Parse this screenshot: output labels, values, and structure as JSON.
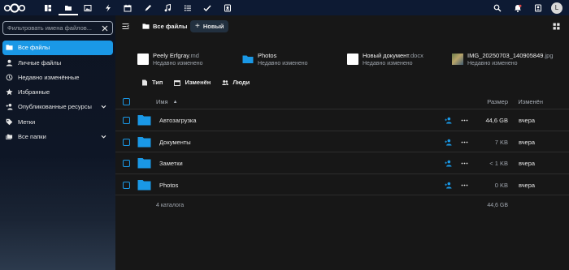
{
  "header": {
    "apps": [
      {
        "icon": "dashboard-icon",
        "active": false
      },
      {
        "icon": "files-icon",
        "active": true
      },
      {
        "icon": "photos-icon",
        "active": false
      },
      {
        "icon": "activity-icon",
        "active": false
      },
      {
        "icon": "calendar-icon",
        "active": false
      },
      {
        "icon": "notes-icon",
        "active": false
      },
      {
        "icon": "music-icon",
        "active": false
      },
      {
        "icon": "tasks-icon",
        "active": false
      },
      {
        "icon": "check-icon",
        "active": false
      },
      {
        "icon": "passwords-icon",
        "active": false
      }
    ],
    "avatar_initial": "L"
  },
  "sidebar": {
    "filter_placeholder": "Фильтровать имена файлов...",
    "items": [
      {
        "label": "Все файлы",
        "icon": "folder-icon",
        "active": true
      },
      {
        "label": "Личные файлы",
        "icon": "account-icon",
        "active": false
      },
      {
        "label": "Недавно изменённые",
        "icon": "history-icon",
        "active": false
      },
      {
        "label": "Избранные",
        "icon": "star-icon",
        "active": false
      },
      {
        "label": "Опубликованные ресурсы",
        "icon": "share-icon",
        "active": false,
        "expandable": true
      },
      {
        "label": "Метки",
        "icon": "tag-icon",
        "active": false
      },
      {
        "label": "Все папки",
        "icon": "folder-multiple-icon",
        "active": false,
        "expandable": true
      }
    ]
  },
  "toolbar": {
    "breadcrumb": "Все файлы",
    "new_label": "Новый"
  },
  "recent": [
    {
      "name": "Peely Erfgray",
      "ext": ".md",
      "sub": "Недавно изменено",
      "thumb": "doc"
    },
    {
      "name": "Photos",
      "ext": "",
      "sub": "Недавно изменено",
      "thumb": "folder"
    },
    {
      "name": "Новый документ",
      "ext": ".docx",
      "sub": "Недавно изменено",
      "thumb": "doc"
    },
    {
      "name": "IMG_20250703_140905849",
      "ext": ".jpg",
      "sub": "Недавно изменено",
      "thumb": "img"
    }
  ],
  "filters": [
    {
      "label": "Тип",
      "icon": "file-type-icon"
    },
    {
      "label": "Изменён",
      "icon": "calendar-icon"
    },
    {
      "label": "Люди",
      "icon": "people-icon"
    }
  ],
  "table": {
    "columns": {
      "name": "Имя",
      "size": "Размер",
      "modified": "Изменён"
    },
    "rows": [
      {
        "name": "Автозагрузка",
        "size": "44,6 GB",
        "modified": "вчера"
      },
      {
        "name": "Документы",
        "size": "7 KB",
        "modified": "вчера"
      },
      {
        "name": "Заметки",
        "size": "< 1 KB",
        "modified": "вчера"
      },
      {
        "name": "Photos",
        "size": "0 KB",
        "modified": "вчера"
      }
    ],
    "summary_count": "4 каталога",
    "summary_size": "44,6 GB"
  },
  "colors": {
    "accent": "#1a98e6",
    "header_bg": "#0d1a33",
    "main_bg": "#171717",
    "folder": "#1a98e6"
  }
}
